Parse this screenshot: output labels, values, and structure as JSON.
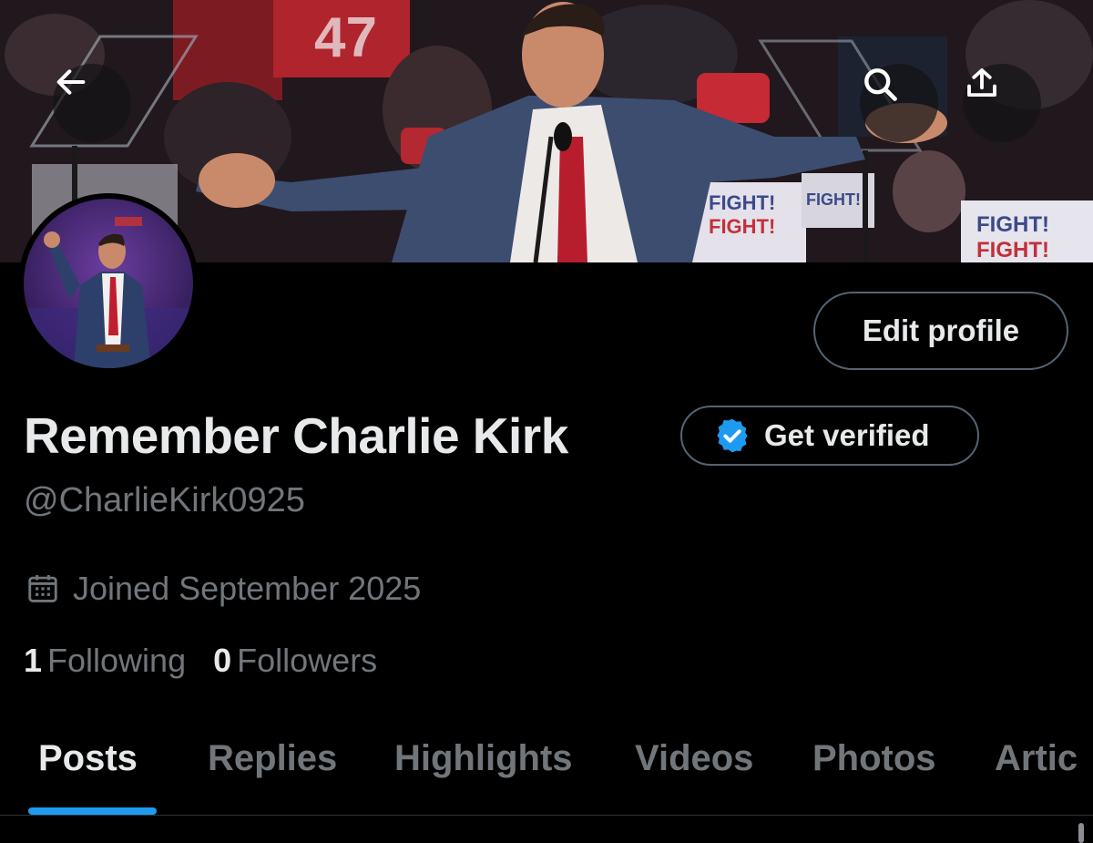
{
  "header": {
    "back_icon": "arrow-left-icon",
    "search_icon": "search-icon",
    "share_icon": "share-upload-icon",
    "banner_signs": [
      "47",
      "FIGHT!",
      "FIGHT!",
      "FIGHT!",
      "FIGHT!",
      "FIGHT!"
    ]
  },
  "profile": {
    "edit_profile_label": "Edit profile",
    "display_name": "Remember Charlie Kirk",
    "get_verified_label": "Get verified",
    "handle": "@CharlieKirk0925",
    "joined_icon": "calendar-icon",
    "joined_text": "Joined September 2025",
    "following_count": "1",
    "following_label": "Following",
    "followers_count": "0",
    "followers_label": "Followers"
  },
  "tabs": [
    {
      "label": "Posts",
      "active": true
    },
    {
      "label": "Replies",
      "active": false
    },
    {
      "label": "Highlights",
      "active": false
    },
    {
      "label": "Videos",
      "active": false
    },
    {
      "label": "Photos",
      "active": false
    },
    {
      "label": "Artic",
      "active": false
    }
  ],
  "colors": {
    "background": "#000000",
    "text_primary": "#e7e9ea",
    "text_secondary": "#71767b",
    "accent": "#1d9bf0",
    "border": "#536471"
  }
}
